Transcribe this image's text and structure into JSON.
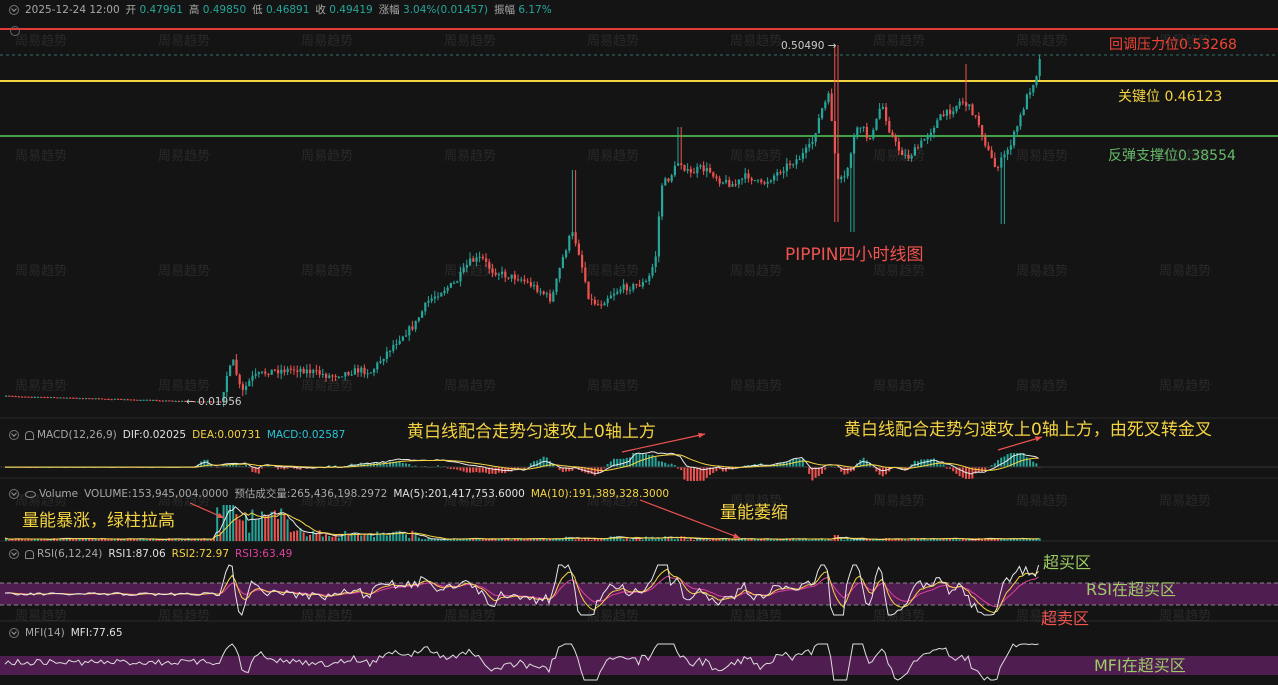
{
  "header": {
    "time": "2025-12-24 12:00",
    "open_label": "开",
    "open": "0.47961",
    "high_label": "高",
    "high": "0.49850",
    "low_label": "低",
    "low": "0.46891",
    "close_label": "收",
    "close": "0.49419",
    "change_label": "涨幅",
    "change": "3.04%(0.01457)",
    "amplitude_label": "振幅",
    "amplitude": "6.17%"
  },
  "levels": {
    "resistance": "回调压力位0.53268",
    "key": "关键位 0.46123",
    "support": "反弹支撑位0.38554"
  },
  "price_labels": {
    "peak": "0.50490",
    "trough": "0.01956"
  },
  "title": "PIPPIN四小时线图",
  "macd": {
    "name": "MACD(12,26,9)",
    "dif": "DIF:0.02025",
    "dea": "DEA:0.00731",
    "macd": "MACD:0.02587",
    "note_left": "黄白线配合走势匀速攻上0轴上方",
    "note_right": "黄白线配合走势匀速攻上0轴上方，由死叉转金叉"
  },
  "volume": {
    "name": "Volume",
    "volume": "VOLUME:153,945,004.0000",
    "estimate": "预估成交量:265,436,198.2972",
    "ma5": "MA(5):201,417,753.6000",
    "ma10": "MA(10):191,389,328.3000",
    "note_left": "量能暴涨，绿柱拉高",
    "note_right": "量能萎缩"
  },
  "rsi": {
    "name": "RSI(6,12,24)",
    "rsi1": "RSI1:87.06",
    "rsi2": "RSI2:72.97",
    "rsi3": "RSI3:63.49",
    "overbought_label": "超买区",
    "inzone_label": "RSI在超买区",
    "oversold_label": "超卖区"
  },
  "mfi": {
    "name": "MFI(14)",
    "mfi": "MFI:77.65",
    "inzone_label": "MFI在超买区"
  },
  "watermark": "周易趋势",
  "colors": {
    "background": "#141414",
    "up": "#26a69a",
    "down": "#ef5350",
    "resistance_line": "#e53935",
    "key_line": "#f5d442",
    "support_line": "#43a047",
    "zone": "#5a1f5a"
  },
  "chart_data": {
    "type": "candlestick",
    "interval": "4h",
    "last_bar": {
      "time": "2025-12-24 12:00",
      "open": 0.47961,
      "high": 0.4985,
      "low": 0.46891,
      "close": 0.49419
    },
    "horizontal_levels": [
      {
        "label": "回调压力位",
        "value": 0.53268
      },
      {
        "label": "关键位",
        "value": 0.46123
      },
      {
        "label": "反弹支撑位",
        "value": 0.38554
      }
    ],
    "marked_high": 0.5049,
    "marked_low": 0.01956,
    "indicators": {
      "macd": {
        "DIF": 0.02025,
        "DEA": 0.00731,
        "MACD": 0.02587
      },
      "volume": {
        "VOLUME": 153945004.0,
        "MA5": 201417753.6,
        "MA10": 191389328.3
      },
      "rsi": {
        "RSI1": 87.06,
        "RSI2": 72.97,
        "RSI3": 63.49
      },
      "mfi": {
        "MFI": 77.65
      }
    }
  }
}
